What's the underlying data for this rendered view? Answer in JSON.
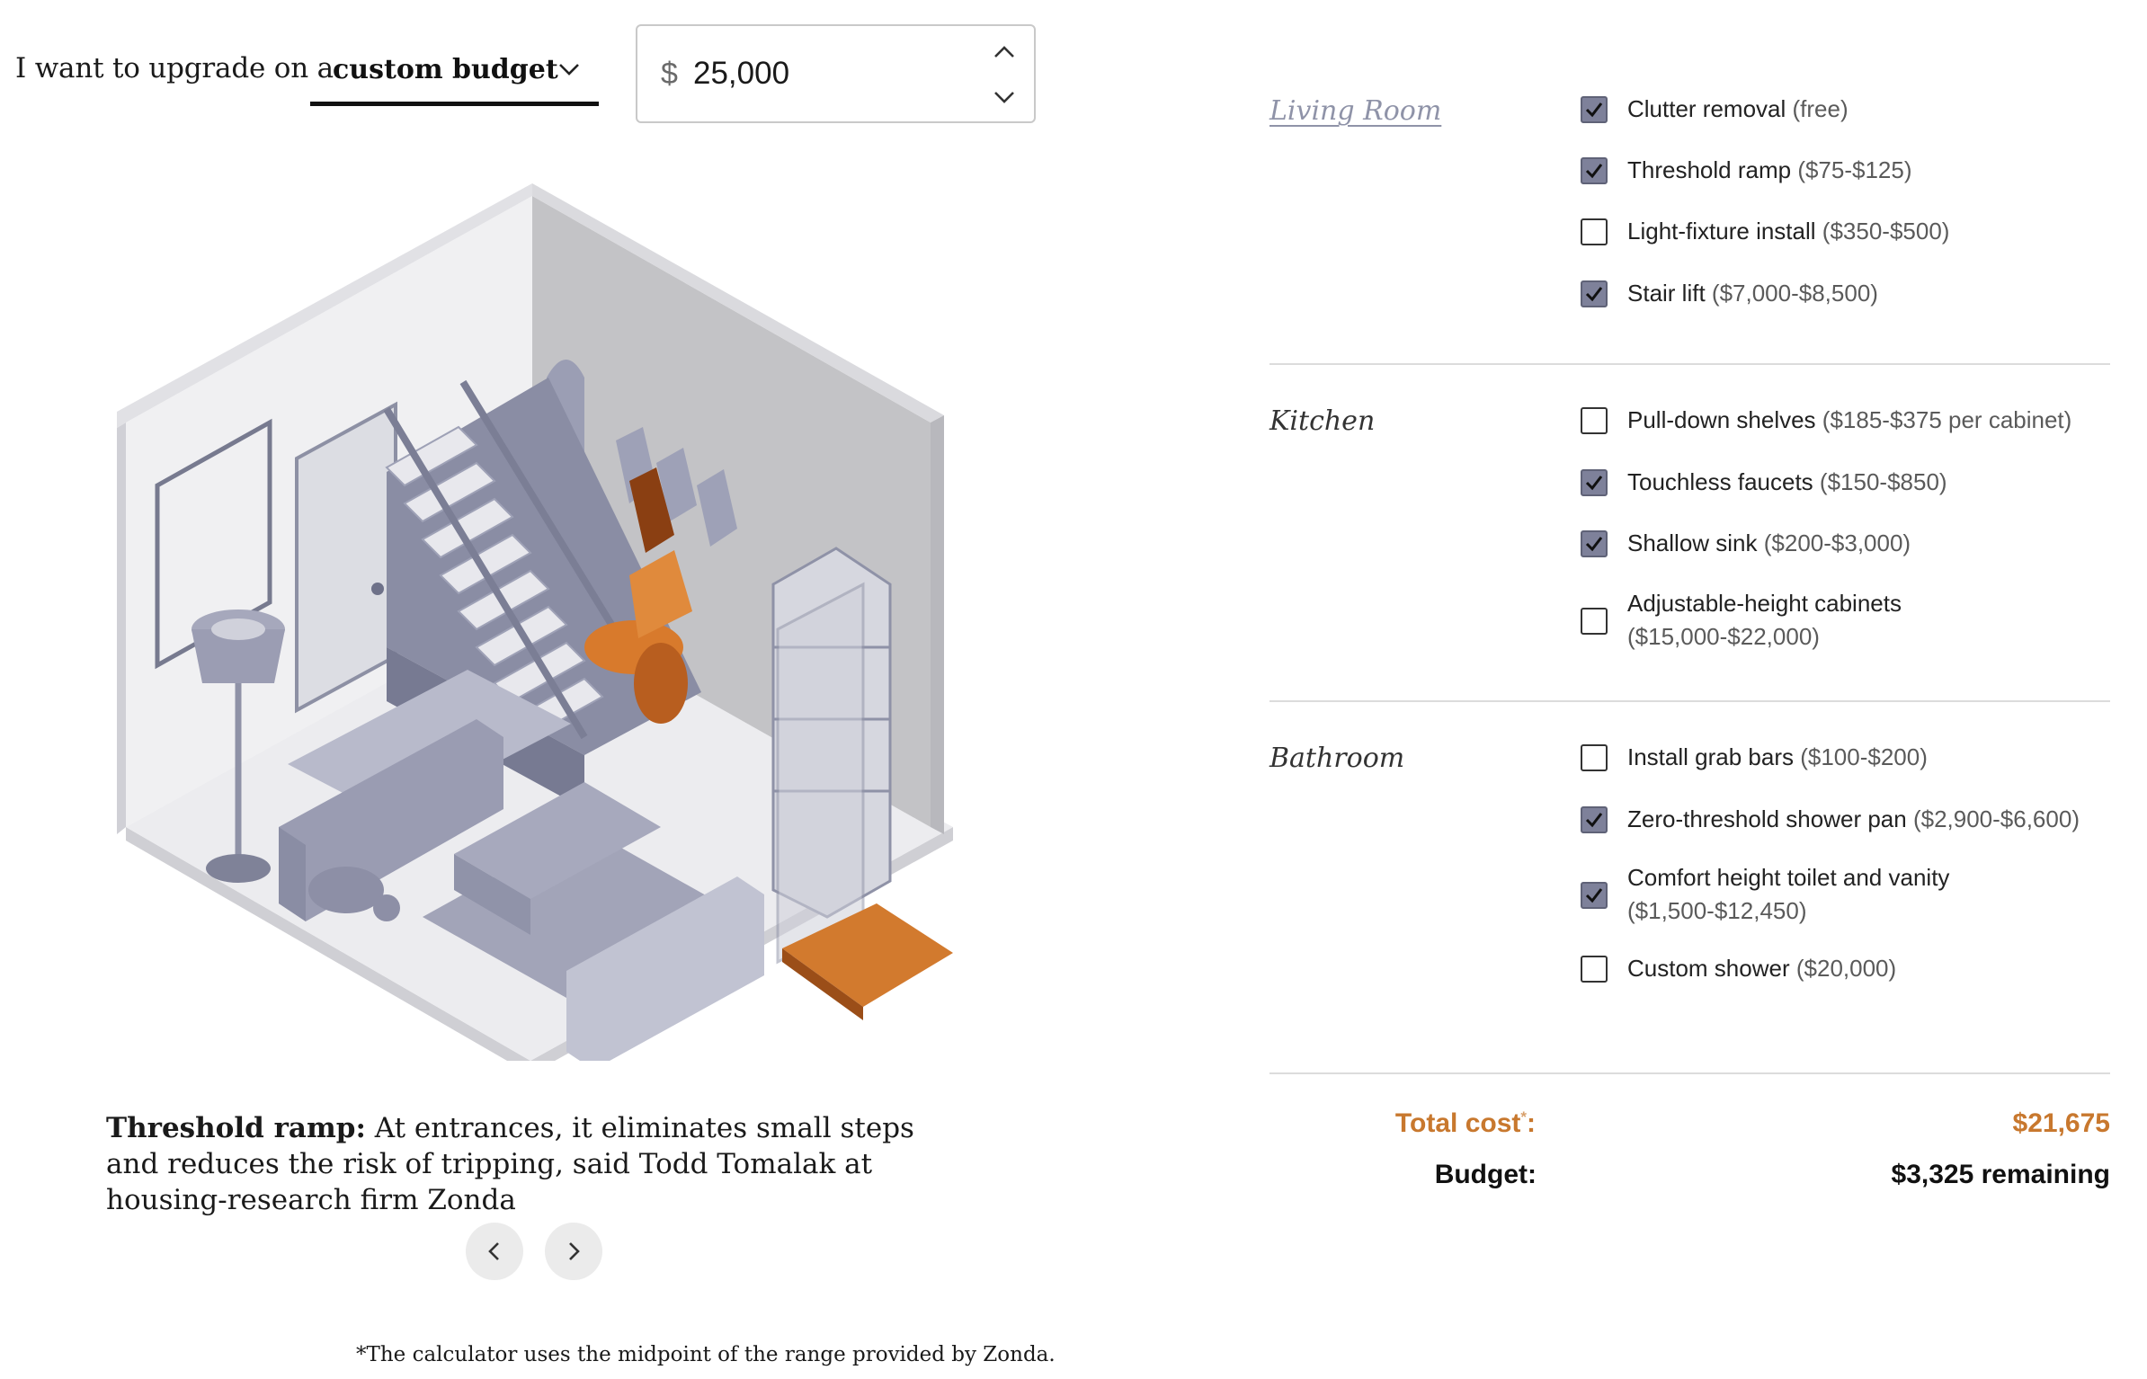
{
  "controls": {
    "intro_text": "I want to upgrade on a",
    "budget_type": "custom budget",
    "currency_symbol": "$",
    "amount": "25,000"
  },
  "caption": {
    "title": "Threshold ramp:",
    "text": " At entrances, it eliminates small steps and reduces the risk of tripping, said Todd Tomalak at housing-research firm Zonda"
  },
  "footnote": "*The calculator uses the midpoint of the range provided by Zonda.",
  "rooms": [
    {
      "name": "Living Room",
      "options": [
        {
          "name": "Clutter removal",
          "price": "(free)",
          "checked": true
        },
        {
          "name": "Threshold ramp",
          "price": "($75-$125)",
          "checked": true
        },
        {
          "name": "Light-fixture install",
          "price": "($350-$500)",
          "checked": false
        },
        {
          "name": "Stair lift",
          "price": "($7,000-$8,500)",
          "checked": true
        }
      ]
    },
    {
      "name": "Kitchen",
      "options": [
        {
          "name": "Pull-down shelves",
          "price": "($185-$375 per cabinet)",
          "checked": false
        },
        {
          "name": "Touchless faucets",
          "price": "($150-$850)",
          "checked": true
        },
        {
          "name": "Shallow sink",
          "price": "($200-$3,000)",
          "checked": true
        },
        {
          "name": "Adjustable-height cabinets",
          "price": "($15,000-$22,000)",
          "checked": false
        }
      ]
    },
    {
      "name": "Bathroom",
      "options": [
        {
          "name": "Install grab bars",
          "price": "($100-$200)",
          "checked": false
        },
        {
          "name": "Zero-threshold shower pan",
          "price": "($2,900-$6,600)",
          "checked": true
        },
        {
          "name": "Comfort height toilet and vanity",
          "price": "($1,500-$12,450)",
          "checked": true
        },
        {
          "name": "Custom shower",
          "price": "($20,000)",
          "checked": false
        }
      ]
    }
  ],
  "summary": {
    "total_label": "Total cost",
    "total_star": "*",
    "total_suffix": ":",
    "total_value": "$21,675",
    "budget_label": "Budget:",
    "budget_value": "$3,325 remaining"
  },
  "colors": {
    "accent_orange": "#c8782e",
    "checkbox_fill": "#7e819a",
    "room_link": "#8f93a8"
  }
}
